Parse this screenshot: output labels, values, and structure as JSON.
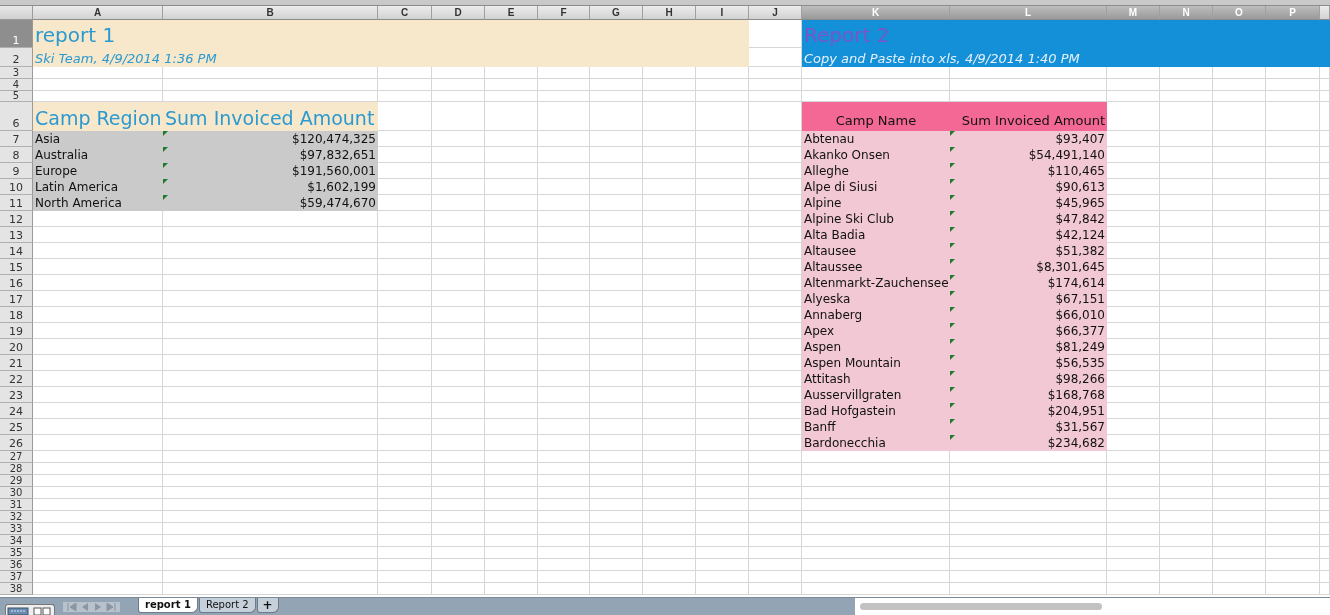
{
  "columns": [
    {
      "label": "A",
      "selected": false
    },
    {
      "label": "B",
      "selected": false
    },
    {
      "label": "C",
      "selected": false
    },
    {
      "label": "D",
      "selected": false
    },
    {
      "label": "E",
      "selected": false
    },
    {
      "label": "F",
      "selected": false
    },
    {
      "label": "G",
      "selected": false
    },
    {
      "label": "H",
      "selected": false
    },
    {
      "label": "I",
      "selected": false
    },
    {
      "label": "J",
      "selected": false
    },
    {
      "label": "K",
      "selected": true
    },
    {
      "label": "L",
      "selected": true
    },
    {
      "label": "M",
      "selected": true
    },
    {
      "label": "N",
      "selected": true
    },
    {
      "label": "O",
      "selected": true
    },
    {
      "label": "P",
      "selected": true
    }
  ],
  "row_numbers": [
    {
      "label": "1",
      "selected": true
    },
    {
      "label": "2",
      "selected": false
    },
    {
      "label": "3",
      "selected": false
    },
    {
      "label": "4",
      "selected": false
    },
    {
      "label": "5",
      "selected": false
    },
    {
      "label": "6",
      "selected": false
    },
    {
      "label": "7",
      "selected": false
    },
    {
      "label": "8",
      "selected": false
    },
    {
      "label": "9",
      "selected": false
    },
    {
      "label": "10",
      "selected": false
    },
    {
      "label": "11",
      "selected": false
    },
    {
      "label": "12",
      "selected": false
    },
    {
      "label": "13",
      "selected": false
    },
    {
      "label": "14",
      "selected": false
    },
    {
      "label": "15",
      "selected": false
    },
    {
      "label": "16",
      "selected": false
    },
    {
      "label": "17",
      "selected": false
    },
    {
      "label": "18",
      "selected": false
    },
    {
      "label": "19",
      "selected": false
    },
    {
      "label": "20",
      "selected": false
    },
    {
      "label": "21",
      "selected": false
    },
    {
      "label": "22",
      "selected": false
    },
    {
      "label": "23",
      "selected": false
    },
    {
      "label": "24",
      "selected": false
    },
    {
      "label": "25",
      "selected": false
    },
    {
      "label": "26",
      "selected": false
    },
    {
      "label": "27",
      "selected": false
    },
    {
      "label": "28",
      "selected": false
    },
    {
      "label": "29",
      "selected": false
    },
    {
      "label": "30",
      "selected": false
    },
    {
      "label": "31",
      "selected": false
    },
    {
      "label": "32",
      "selected": false
    },
    {
      "label": "33",
      "selected": false
    },
    {
      "label": "34",
      "selected": false
    },
    {
      "label": "35",
      "selected": false
    },
    {
      "label": "36",
      "selected": false
    },
    {
      "label": "37",
      "selected": false
    },
    {
      "label": "38",
      "selected": false
    }
  ],
  "reports": [
    {
      "kind": "warm",
      "title": "report 1",
      "subtitle": "Ski Team, 4/9/2014 1:36 PM",
      "headers": [
        "Camp Region",
        "Sum Invoiced Amount"
      ],
      "rows": [
        {
          "name": "Asia",
          "amount": "$120,474,325",
          "flagged": true
        },
        {
          "name": "Australia",
          "amount": "$97,832,651",
          "flagged": true
        },
        {
          "name": "Europe",
          "amount": "$191,560,001",
          "flagged": true
        },
        {
          "name": "Latin America",
          "amount": "$1,602,199",
          "flagged": true
        },
        {
          "name": "North America",
          "amount": "$59,474,670",
          "flagged": true
        }
      ]
    },
    {
      "kind": "cool",
      "title": "Report 2",
      "subtitle": "Copy and Paste into xls, 4/9/2014 1:40 PM",
      "headers": [
        "Camp Name",
        "Sum Invoiced Amount"
      ],
      "rows": [
        {
          "name": "Abtenau",
          "amount": "$93,407",
          "flagged": true
        },
        {
          "name": "Akanko Onsen",
          "amount": "$54,491,140",
          "flagged": true
        },
        {
          "name": "Alleghe",
          "amount": "$110,465",
          "flagged": true
        },
        {
          "name": "Alpe di Siusi",
          "amount": "$90,613",
          "flagged": true
        },
        {
          "name": "Alpine",
          "amount": "$45,965",
          "flagged": true
        },
        {
          "name": "Alpine Ski Club",
          "amount": "$47,842",
          "flagged": true
        },
        {
          "name": "Alta Badia",
          "amount": "$42,124",
          "flagged": true
        },
        {
          "name": "Altausee",
          "amount": "$51,382",
          "flagged": true
        },
        {
          "name": "Altaussee",
          "amount": "$8,301,645",
          "flagged": true
        },
        {
          "name": "Altenmarkt-Zauchensee",
          "amount": "$174,614",
          "flagged": true
        },
        {
          "name": "Alyeska",
          "amount": "$67,151",
          "flagged": true
        },
        {
          "name": "Annaberg",
          "amount": "$66,010",
          "flagged": true
        },
        {
          "name": "Apex",
          "amount": "$66,377",
          "flagged": true
        },
        {
          "name": "Aspen",
          "amount": "$81,249",
          "flagged": true
        },
        {
          "name": "Aspen Mountain",
          "amount": "$56,535",
          "flagged": true
        },
        {
          "name": "Attitash",
          "amount": "$98,266",
          "flagged": true
        },
        {
          "name": "Ausservillgraten",
          "amount": "$168,768",
          "flagged": true
        },
        {
          "name": "Bad Hofgastein",
          "amount": "$204,951",
          "flagged": true
        },
        {
          "name": "Banff",
          "amount": "$31,567",
          "flagged": true
        },
        {
          "name": "Bardonecchia",
          "amount": "$234,682",
          "flagged": true
        }
      ]
    }
  ],
  "sheet_tabs": [
    {
      "label": "report 1",
      "selected": true
    },
    {
      "label": "Report 2",
      "selected": false
    }
  ],
  "add_tab": "+"
}
